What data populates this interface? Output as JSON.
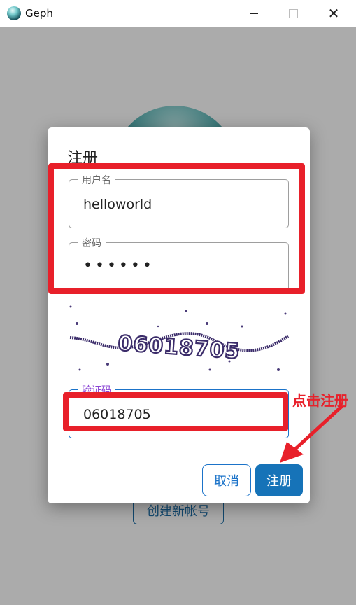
{
  "window": {
    "title": "Geph",
    "minimize_icon": "minimize-icon",
    "maximize_icon": "maximize-icon",
    "close_icon": "close-icon"
  },
  "background": {
    "create_account_label": "创建新帐号"
  },
  "dialog": {
    "title": "注册",
    "username": {
      "label": "用户名",
      "value": "helloworld"
    },
    "password": {
      "label": "密码",
      "value": "••••••"
    },
    "captcha": {
      "text": "06018705"
    },
    "captcha_field": {
      "label": "验证码",
      "value": "06018705"
    },
    "cancel_label": "取消",
    "register_label": "注册"
  },
  "annotation": {
    "text": "点击注册",
    "color": "#e8202a"
  },
  "colors": {
    "accent": "#1673b8",
    "captcha_label": "#8a44d4",
    "highlight": "#e8202a"
  }
}
